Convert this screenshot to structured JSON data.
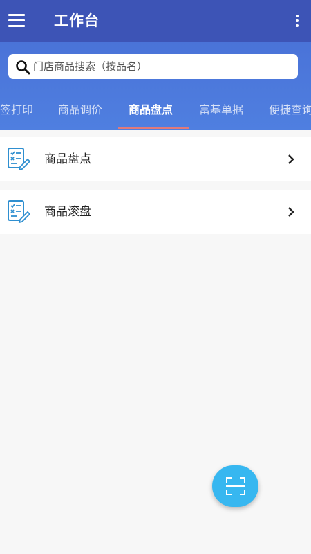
{
  "appbar": {
    "title": "工作台",
    "menu_icon": "menu-icon",
    "more_icon": "more-vertical-icon"
  },
  "search": {
    "placeholder": "门店商品搜索（按品名）",
    "icon": "search-icon"
  },
  "tabs": [
    {
      "label": "签打印",
      "active": false
    },
    {
      "label": "商品调价",
      "active": false
    },
    {
      "label": "商品盘点",
      "active": true
    },
    {
      "label": "富基单据",
      "active": false
    },
    {
      "label": "便捷查询",
      "active": false
    }
  ],
  "list": [
    {
      "label": "商品盘点",
      "icon": "checklist-edit-icon"
    },
    {
      "label": "商品滚盘",
      "icon": "checklist-edit-icon"
    }
  ],
  "fab": {
    "icon": "scan-icon"
  },
  "colors": {
    "appbar": "#3d54b6",
    "header": "#4f7fe0",
    "tab_indicator": "#e07a7a",
    "fab": "#37b7f0",
    "icon_blue": "#2f8fd0"
  }
}
